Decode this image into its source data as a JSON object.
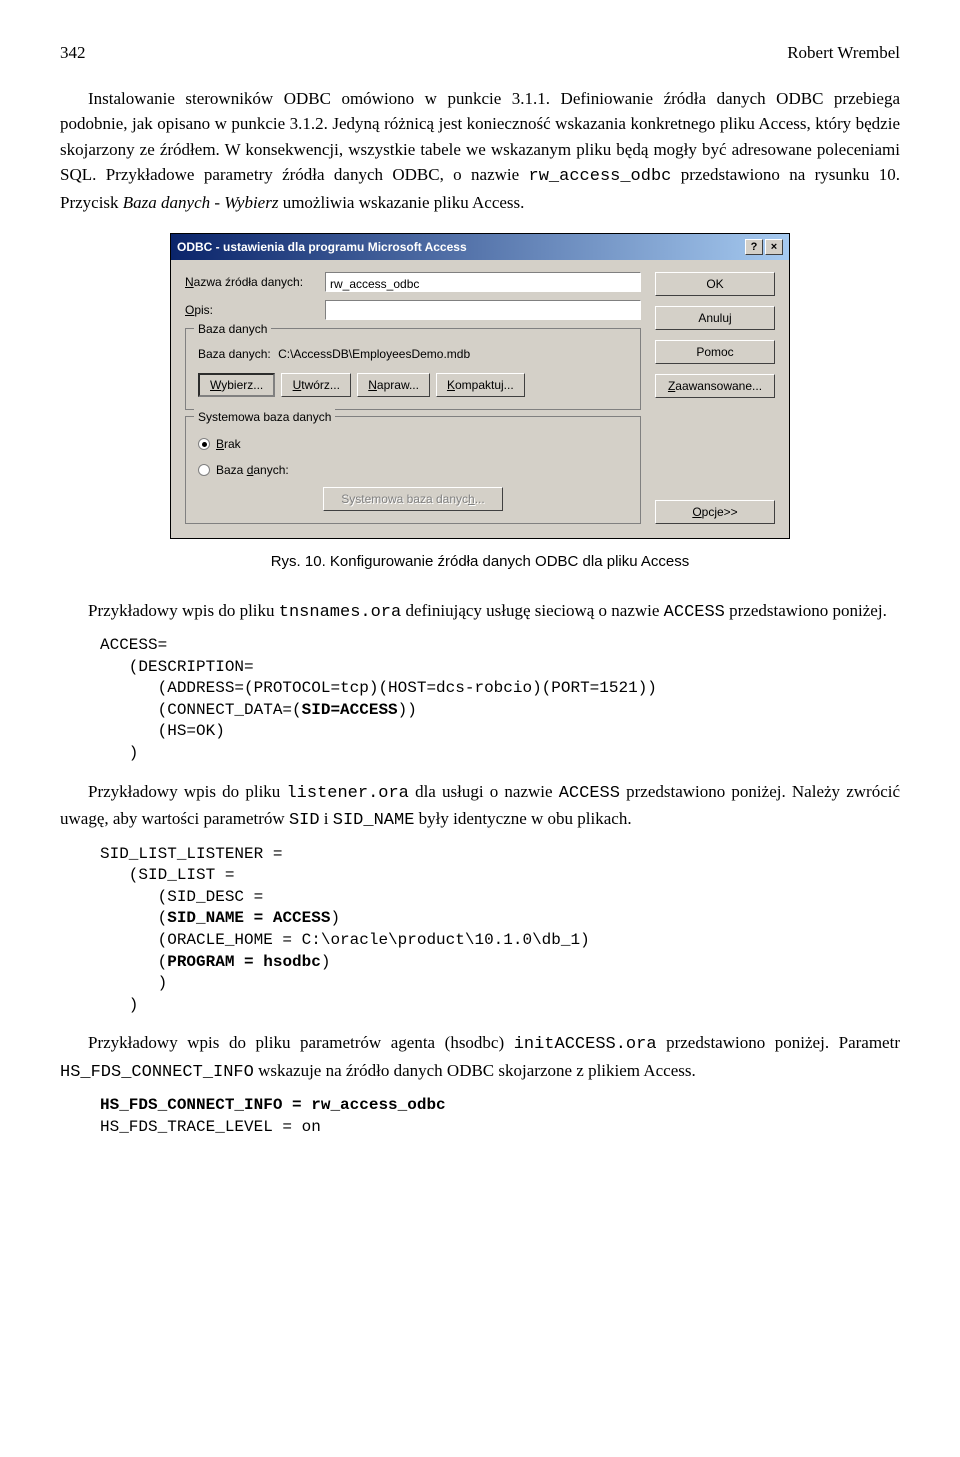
{
  "page": {
    "number": "342",
    "author": "Robert Wrembel"
  },
  "para1": {
    "text_a": "Instalowanie sterowników ODBC omówiono w punkcie 3.1.1. Definiowanie źródła danych ODBC przebiega podobnie, jak opisano w punkcie 3.1.2. Jedyną różnicą jest konieczność wskazania konkretnego pliku Access, który będzie skojarzony ze źródłem. W konsekwencji, wszystkie tabele we wskazanym pliku będą mogły być adresowane poleceniami SQL. Przykładowe parametry źródła danych ODBC, o nazwie ",
    "code": "rw_access_odbc",
    "text_b": " przedstawiono na rysunku 10. Przycisk ",
    "italic": "Baza danych - Wybierz",
    "text_c": " umożliwia wskazanie pliku Access."
  },
  "dialog": {
    "title": "ODBC - ustawienia dla programu Microsoft Access",
    "help": "?",
    "close": "×",
    "name_label_pre": "N",
    "name_label": "azwa źródła danych:",
    "name_value": "rw_access_odbc",
    "desc_label_pre": "O",
    "desc_label": "pis:",
    "db_legend": "Baza danych",
    "db_label": "Baza danych:",
    "db_path": "C:\\AccessDB\\EmployeesDemo.mdb",
    "btn_select_pre": "W",
    "btn_select": "ybierz...",
    "btn_create_pre": "U",
    "btn_create": "twórz...",
    "btn_repair_pre": "N",
    "btn_repair": "apraw...",
    "btn_compact_pre": "K",
    "btn_compact": "ompaktuj...",
    "sys_legend": "Systemowa baza danych",
    "radio_none_pre": "B",
    "radio_none": "rak",
    "radio_db_pre": "d",
    "radio_db_a": "Baza ",
    "radio_db_b": "anych:",
    "btn_sys_pre": "h",
    "btn_sys_a": "Systemowa baza danyc",
    "btn_sys_b": "...",
    "btn_ok": "OK",
    "btn_cancel": "Anuluj",
    "btn_help": "Pomoc",
    "btn_adv_pre": "Z",
    "btn_adv": "aawansowane...",
    "btn_opt_pre": "O",
    "btn_opt": "pcje>>"
  },
  "caption": "Rys. 10. Konfigurowanie źródła danych ODBC dla pliku Access",
  "para2": {
    "a": "Przykładowy wpis do pliku ",
    "m1": "tnsnames.ora",
    "b": " definiujący usługę sieciową o nazwie ",
    "m2": "ACCESS",
    "c": " przedstawiono poniżej."
  },
  "code1": "ACCESS=\n   (DESCRIPTION=\n      (ADDRESS=(PROTOCOL=tcp)(HOST=dcs-robcio)(PORT=1521))\n      (CONNECT_DATA=(<b>SID=ACCESS</b>))\n      (HS=OK)\n   )",
  "para3": {
    "a": "Przykładowy wpis do pliku ",
    "m1": "listener.ora",
    "b": " dla usługi o nazwie ",
    "m2": "ACCESS",
    "c": " przedstawiono poniżej. Należy zwrócić uwagę, aby wartości parametrów ",
    "m3": "SID",
    "d": " i ",
    "m4": "SID_NAME",
    "e": " były identyczne w obu plikach."
  },
  "code2": "SID_LIST_LISTENER =\n   (SID_LIST =\n      (SID_DESC =\n      (<b>SID_NAME = ACCESS</b>)\n      (ORACLE_HOME = C:\\oracle\\product\\10.1.0\\db_1)\n      (<b>PROGRAM = hsodbc</b>)\n      )\n   )",
  "para4": {
    "a": "Przykładowy wpis do pliku parametrów agenta (hsodbc) ",
    "m1": "initACCESS.ora",
    "b": " przedstawiono poniżej. Parametr ",
    "m2": "HS_FDS_CONNECT_INFO",
    "c": " wskazuje na źródło danych ODBC skojarzone z plikiem Access."
  },
  "code3": "<b>HS_FDS_CONNECT_INFO = rw_access_odbc</b>\nHS_FDS_TRACE_LEVEL = on"
}
